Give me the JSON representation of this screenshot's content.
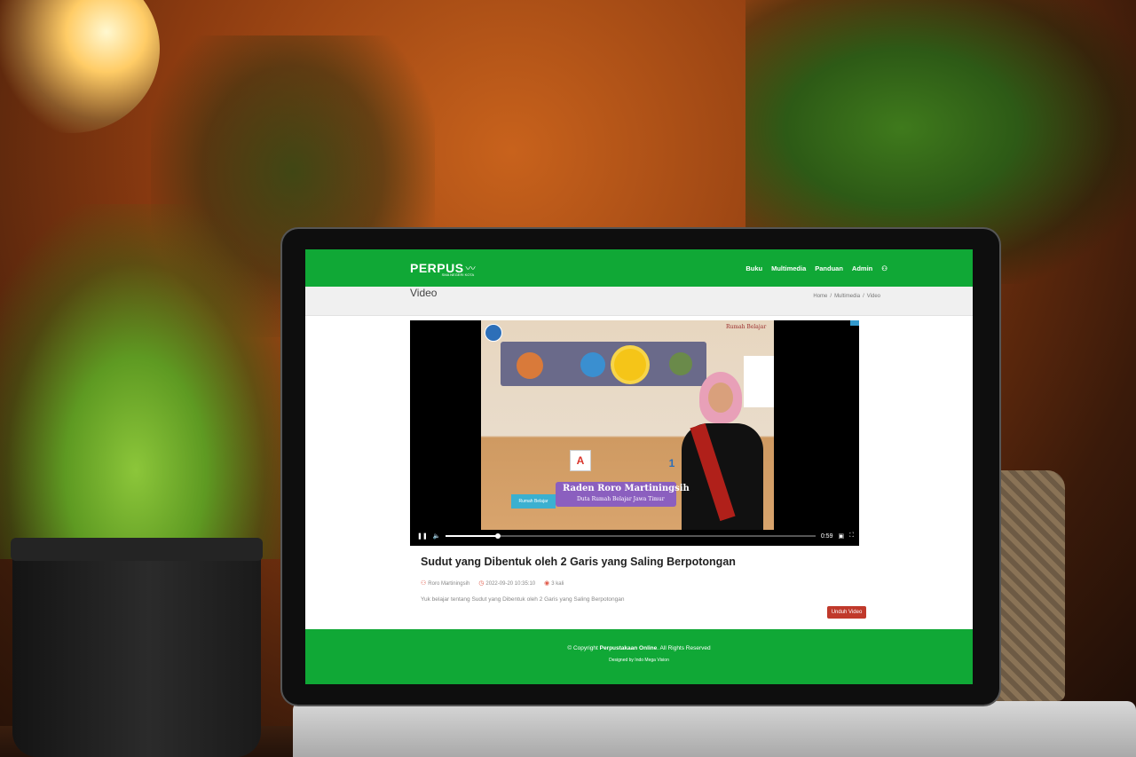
{
  "nav": {
    "brand": "PERPUS",
    "brand_sub": "SMA NEGERI KOTA",
    "menu": [
      "Buku",
      "Multimedia",
      "Panduan",
      "Admin"
    ]
  },
  "page": {
    "title": "Video",
    "breadcrumb": [
      "Home",
      "/",
      "Multimedia",
      "/",
      "Video"
    ]
  },
  "player": {
    "nameplate_name": "Raden Roro Martiningsih",
    "nameplate_subtitle": "Duta Rumah Belajar Jawa Timur",
    "watermark": "Rumah Belajar",
    "channel_logo": "Rumah Belajar",
    "time": "0:59",
    "progress": 0.14,
    "cards": [
      "A",
      "1"
    ]
  },
  "video": {
    "title": "Sudut yang Dibentuk oleh 2 Garis yang Saling Berpotongan",
    "author": "Roro Martiningsih",
    "date": "2022-09-20 10:35:10",
    "views": "3 kali",
    "description": "Yuk belajar tentang Sudut yang Dibentuk oleh 2 Garis yang Saling Berpotongan",
    "download_label": "Unduh Video"
  },
  "footer": {
    "copyright_prefix": "© Copyright ",
    "copyright_name": "Perpustakaan Online",
    "copyright_suffix": ". All Rights Reserved",
    "designed": "Designed by Indo Mega Vision"
  },
  "colors": {
    "primary": "#10a836",
    "download": "#c0392b"
  }
}
